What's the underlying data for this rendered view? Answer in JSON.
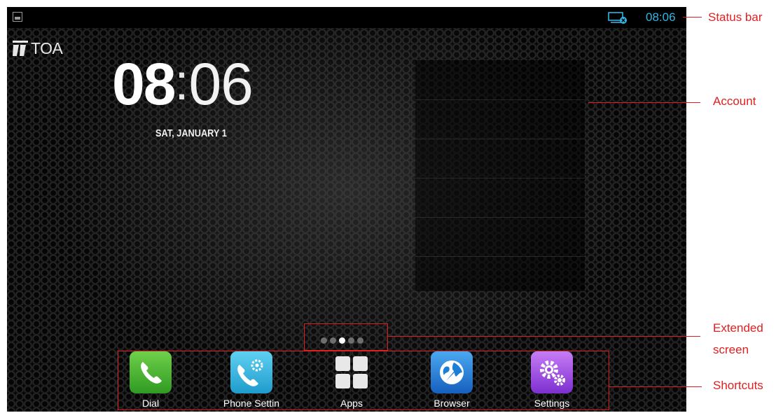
{
  "status_bar": {
    "time": "08:06"
  },
  "logo": {
    "text": "TOA"
  },
  "clock": {
    "hour": "08",
    "separator": ":",
    "minute": "06",
    "date": "SAT, JANUARY 1"
  },
  "page_indicator": {
    "count": 5,
    "active_index": 2
  },
  "shortcuts": [
    {
      "label": "Dial",
      "icon": "phone-icon",
      "color": "#3aa829"
    },
    {
      "label": "Phone Settin",
      "icon": "phone-settings-icon",
      "color": "#2aaedc"
    },
    {
      "label": "Apps",
      "icon": "apps-grid-icon",
      "color": "#ffffff"
    },
    {
      "label": "Browser",
      "icon": "globe-icon",
      "color": "#1c7fd6"
    },
    {
      "label": "Settings",
      "icon": "gear-icon",
      "color": "#9b45e0"
    }
  ],
  "annotations": {
    "status_bar": "Status bar",
    "account": "Account",
    "extended_screen_1": "Extended",
    "extended_screen_2": "screen",
    "shortcuts": "Shortcuts"
  },
  "colors": {
    "annotation": "#e02020",
    "status_accent": "#33b5e5"
  }
}
